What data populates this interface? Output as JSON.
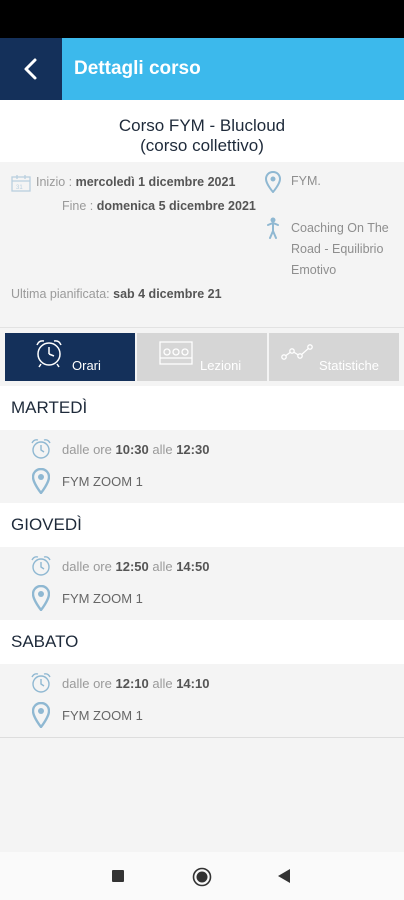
{
  "header": {
    "title": "Dettagli corso"
  },
  "course": {
    "title_line1": "Corso FYM - Blucloud",
    "title_line2": "(corso collettivo)"
  },
  "info": {
    "start_label": "Inizio : ",
    "start_value": "mercoledì 1 dicembre 2021",
    "end_label": "Fine : ",
    "end_value": "domenica 5 dicembre 2021",
    "location": "FYM.",
    "coach": "Coaching On The Road - Equilibrio Emotivo",
    "last_planned_label": "Ultima pianificata: ",
    "last_planned_value": "sab 4 dicembre 21"
  },
  "tabs": [
    {
      "label": "Orari",
      "icon": "alarm-clock-icon"
    },
    {
      "label": "Lezioni",
      "icon": "lessons-icon"
    },
    {
      "label": "Statistiche",
      "icon": "stats-icon"
    }
  ],
  "schedule": [
    {
      "day": "MARTEDÌ",
      "from_label": "dalle ore ",
      "from": "10:30",
      "to_label": " alle ",
      "to": "12:30",
      "room": "FYM ZOOM 1"
    },
    {
      "day": "GIOVEDÌ",
      "from_label": "dalle ore ",
      "from": "12:50",
      "to_label": " alle ",
      "to": "14:50",
      "room": "FYM ZOOM 1"
    },
    {
      "day": "SABATO",
      "from_label": "dalle ore ",
      "from": "12:10",
      "to_label": " alle ",
      "to": "14:10",
      "room": "FYM ZOOM 1"
    }
  ],
  "colors": {
    "header": "#3cb9ec",
    "dark": "#14305a",
    "tab_inactive": "#d6d6d6",
    "icon": "#8fb8d2"
  }
}
